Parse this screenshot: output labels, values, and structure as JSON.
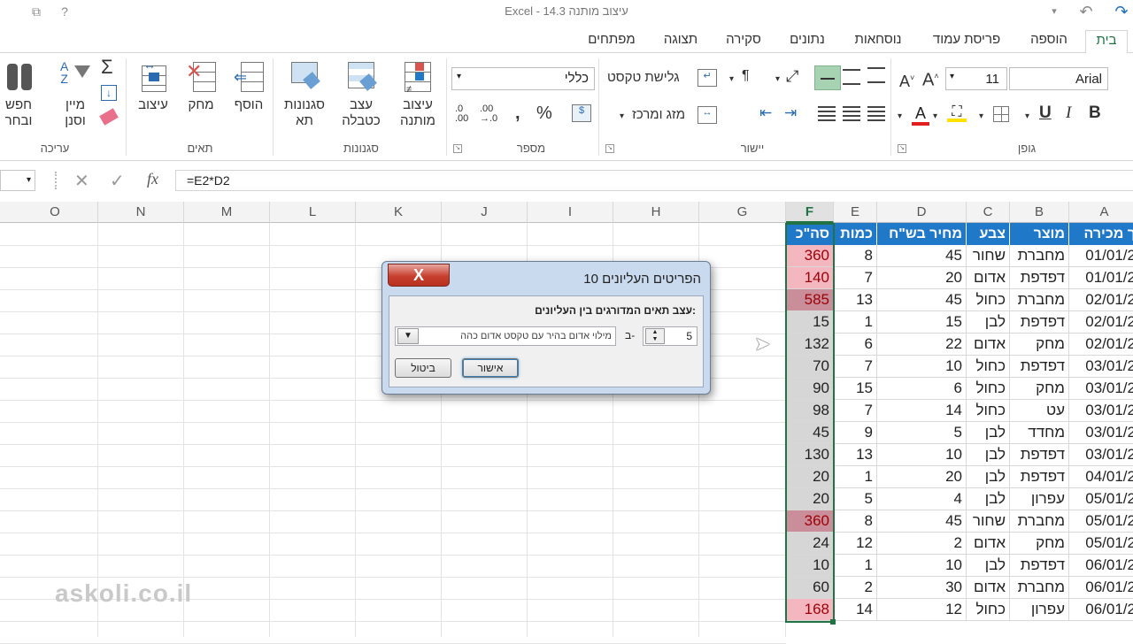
{
  "titlebar": {
    "title": "Excel - עיצוב מותנה 14.3",
    "icons": [
      "restore-icon",
      "help-icon",
      "undo-icon",
      "redo-icon",
      "dropdown-icon"
    ]
  },
  "tabs": [
    "בית",
    "הוספה",
    "פריסת עמוד",
    "נוסחאות",
    "נתונים",
    "סקירה",
    "תצוגה",
    "מפתחים"
  ],
  "ribbon": {
    "font": {
      "name": "Arial",
      "size": "11",
      "group": "גופן"
    },
    "align": {
      "wrap": "גלישת טקסט",
      "merge": "מזג ומרכז",
      "group": "יישור"
    },
    "number": {
      "format": "כללי",
      "group": "מספר"
    },
    "styles": {
      "conditional_1": "עיצוב",
      "conditional_2": "מותנה",
      "table_1": "עצב",
      "table_2": "כטבלה",
      "cell_1": "סגנונות",
      "cell_2": "תא",
      "group": "סגנונות"
    },
    "cells": {
      "insert": "הוסף",
      "delete": "מחק",
      "format": "עיצוב",
      "group": "תאים"
    },
    "editing": {
      "sort_1": "מיין",
      "sort_2": "וסנן",
      "find_1": "חפש",
      "find_2": "ובחר",
      "group": "עריכה"
    }
  },
  "formula_bar": {
    "formula": "=E2*D2",
    "fx": "fx"
  },
  "columns": [
    "O",
    "N",
    "M",
    "L",
    "K",
    "J",
    "I",
    "H",
    "G",
    "F",
    "E",
    "D",
    "C",
    "B",
    "A"
  ],
  "table": {
    "headers": {
      "F": "סה\"כ",
      "E": "כמות",
      "D": "מחיר בש\"ח",
      "C": "צבע",
      "B": "מוצר",
      "A": "ך מכירה"
    },
    "rows": [
      {
        "A": "01/01/2",
        "B": "מחברת",
        "C": "שחור",
        "D": "45",
        "E": "8",
        "F": "360",
        "hl": true
      },
      {
        "A": "01/01/2",
        "B": "דפדפת",
        "C": "אדום",
        "D": "20",
        "E": "7",
        "F": "140",
        "hl": true
      },
      {
        "A": "02/01/2",
        "B": "מחברת",
        "C": "כחול",
        "D": "45",
        "E": "13",
        "F": "585",
        "hl": true
      },
      {
        "A": "02/01/2",
        "B": "דפדפת",
        "C": "לבן",
        "D": "15",
        "E": "1",
        "F": "15",
        "hl": false
      },
      {
        "A": "02/01/2",
        "B": "מחק",
        "C": "אדום",
        "D": "22",
        "E": "6",
        "F": "132",
        "hl": false
      },
      {
        "A": "03/01/2",
        "B": "דפדפת",
        "C": "כחול",
        "D": "10",
        "E": "7",
        "F": "70",
        "hl": false
      },
      {
        "A": "03/01/2",
        "B": "מחק",
        "C": "כחול",
        "D": "6",
        "E": "15",
        "F": "90",
        "hl": false
      },
      {
        "A": "03/01/2",
        "B": "עט",
        "C": "כחול",
        "D": "14",
        "E": "7",
        "F": "98",
        "hl": false
      },
      {
        "A": "03/01/2",
        "B": "מחדד",
        "C": "לבן",
        "D": "5",
        "E": "9",
        "F": "45",
        "hl": false
      },
      {
        "A": "03/01/2",
        "B": "דפדפת",
        "C": "לבן",
        "D": "10",
        "E": "13",
        "F": "130",
        "hl": false
      },
      {
        "A": "04/01/2",
        "B": "דפדפת",
        "C": "לבן",
        "D": "20",
        "E": "1",
        "F": "20",
        "hl": false
      },
      {
        "A": "05/01/2",
        "B": "עפרון",
        "C": "לבן",
        "D": "4",
        "E": "5",
        "F": "20",
        "hl": false
      },
      {
        "A": "05/01/2",
        "B": "מחברת",
        "C": "שחור",
        "D": "45",
        "E": "8",
        "F": "360",
        "hl": true
      },
      {
        "A": "05/01/2",
        "B": "מחק",
        "C": "אדום",
        "D": "2",
        "E": "12",
        "F": "24",
        "hl": false
      },
      {
        "A": "06/01/2",
        "B": "דפדפת",
        "C": "לבן",
        "D": "10",
        "E": "1",
        "F": "10",
        "hl": false
      },
      {
        "A": "06/01/2",
        "B": "מחברת",
        "C": "אדום",
        "D": "30",
        "E": "2",
        "F": "60",
        "hl": false
      },
      {
        "A": "06/01/2",
        "B": "עפרון",
        "C": "כחול",
        "D": "12",
        "E": "14",
        "F": "168",
        "hl": true
      }
    ]
  },
  "dialog": {
    "title": "10 הפריטים העליונים",
    "instruction": "עצב תאים המדורגים בין העליונים:",
    "count": "5",
    "with_label": "ב-",
    "format_option": "מילוי אדום בהיר עם טקסט אדום כהה",
    "ok": "אישור",
    "cancel": "ביטול",
    "close": "X"
  },
  "watermark": "askoli.co.il",
  "colors": {
    "accent": "#217346",
    "header_fill": "#1f78c8",
    "highlight": "#f4b6bf",
    "gray_fill": "#d6d6d6"
  }
}
